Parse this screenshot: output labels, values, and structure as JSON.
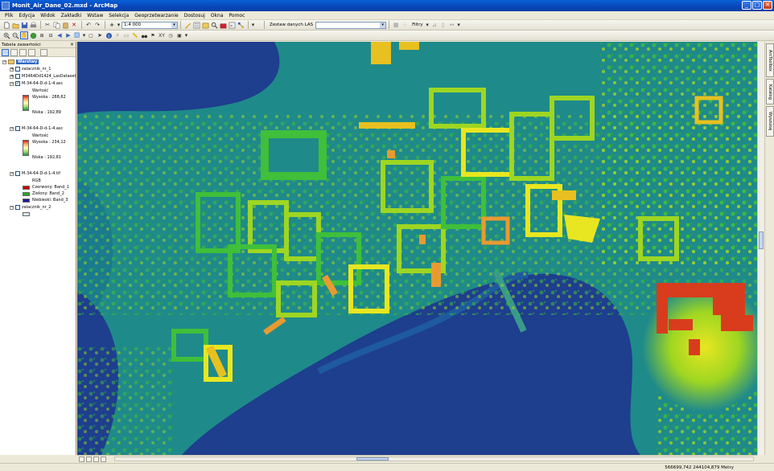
{
  "window": {
    "title": "Monit_Air_Dane_02.mxd - ArcMap",
    "buttons": {
      "minimize": "_",
      "maximize": "□",
      "close": "✕"
    }
  },
  "menu": [
    "Plik",
    "Edycja",
    "Widok",
    "Zakładki",
    "Wstaw",
    "Selekcja",
    "Geoprzetwarzanie",
    "Dostosuj",
    "Okna",
    "Pomoc"
  ],
  "toolbar": {
    "scale_value": "1:4 000",
    "las_dataset_label": "Zestaw danych LAS",
    "las_dataset_value": "",
    "filters_label": "Filtry"
  },
  "toc": {
    "header": "Tabela zawartości",
    "close": "×",
    "group": "Warstwy",
    "layers": [
      {
        "name": "zalacznik_nr_1",
        "checked": false
      },
      {
        "name": "M3464Dd1424_LasDataset",
        "checked": false
      },
      {
        "name": "M-34-64-D-d-1-4.asc",
        "checked": true,
        "legend_title": "Wartość",
        "high": "Wysoka : 288,62",
        "low": "Niska : 192,89"
      },
      {
        "name": "M-34-64-D-d-1-4.asc",
        "checked": false,
        "legend_title": "Wartość",
        "high": "Wysoka : 234,12",
        "low": "Niska : 192,81"
      },
      {
        "name": "M-34-64-D-d-1-4.tif",
        "checked": false,
        "legend_title": "RGB",
        "bands": [
          {
            "label": "Czerwony:  Band_1",
            "color": "#cc0000"
          },
          {
            "label": "Zielony:  Band_2",
            "color": "#22aa22"
          },
          {
            "label": "Niebieski:  Band_3",
            "color": "#1a1a9c"
          }
        ]
      },
      {
        "name": "zalacznik_nr_2",
        "checked": false
      }
    ]
  },
  "right_dock": [
    "ArcToolbox",
    "Katalog",
    "Wyszukaj"
  ],
  "status": {
    "coordinates": "566699,742  244104,879 Metry"
  },
  "colors": {
    "water": "#1e3e8e",
    "ground": "#1f8a8a",
    "low_green": "#2f9e4a",
    "green": "#3fbf3a",
    "yellow_green": "#9ed622",
    "yellow": "#e8e620",
    "orange": "#e89a30",
    "red": "#d83c1c"
  }
}
